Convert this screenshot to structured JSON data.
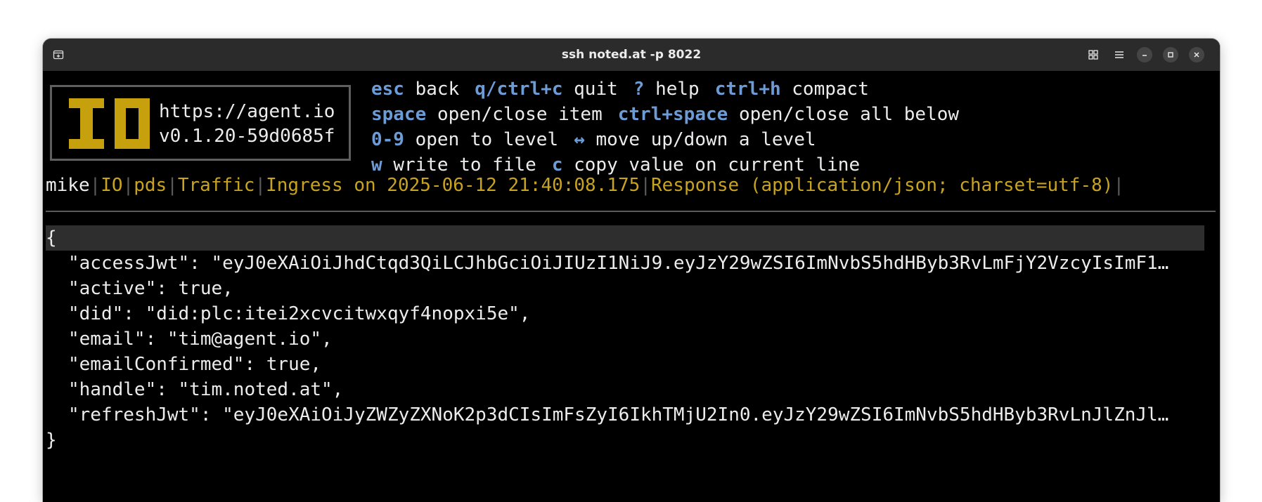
{
  "window": {
    "title": "ssh noted.at -p 8022",
    "left_icon": "new-tab-icon",
    "buttons": [
      "grid-view-icon",
      "hamburger-menu-icon",
      "minimize-icon",
      "maximize-icon",
      "close-icon"
    ]
  },
  "logo": {
    "letters": "IO",
    "color": "#c7a00e",
    "url": "https://agent.io",
    "version": "v0.1.20-59d0685f"
  },
  "help": {
    "rows": [
      [
        {
          "key": "esc",
          "desc": "back"
        },
        {
          "key": "q/ctrl+c",
          "desc": "quit"
        },
        {
          "key": "?",
          "desc": "help"
        },
        {
          "key": "ctrl+h",
          "desc": "compact"
        }
      ],
      [
        {
          "key": "space",
          "desc": "open/close item"
        },
        {
          "key": "ctrl+space",
          "desc": "open/close all below"
        }
      ],
      [
        {
          "key": "0-9",
          "desc": "open to level"
        },
        {
          "key": "↔",
          "desc": "move up/down a level"
        }
      ],
      [
        {
          "key": "w",
          "desc": "write to file"
        },
        {
          "key": "c",
          "desc": "copy value on current line"
        }
      ]
    ]
  },
  "breadcrumb": {
    "current": "mike",
    "items": [
      "IO",
      "pds",
      "Traffic",
      "Ingress on 2025-06-12 21:40:08.175",
      "Response (application/json; charset=utf-8)"
    ]
  },
  "json_view": {
    "open": "{",
    "close": "}",
    "lines": [
      "\"accessJwt\": \"eyJ0eXAiOiJhdCtqd3QiLCJhbGciOiJIUzI1NiJ9.eyJzY29wZSI6ImNvbS5hdHByb3RvLmFjY2VzcyIsImF1…",
      "\"active\": true,",
      "\"did\": \"did:plc:itei2xcvcitwxqyf4nopxi5e\",",
      "\"email\": \"tim@agent.io\",",
      "\"emailConfirmed\": true,",
      "\"handle\": \"tim.noted.at\",",
      "\"refreshJwt\": \"eyJ0eXAiOiJyZWZyZXNoK2p3dCIsImFsZyI6IkhTMjU2In0.eyJzY29wZSI6ImNvbS5hdHByb3RvLnJlZnJl…"
    ]
  },
  "colors": {
    "help_key": "#6d9bd6",
    "breadcrumb": "#c7a321",
    "separator": "#5a5a5a",
    "highlight": "#2e2e2e"
  }
}
